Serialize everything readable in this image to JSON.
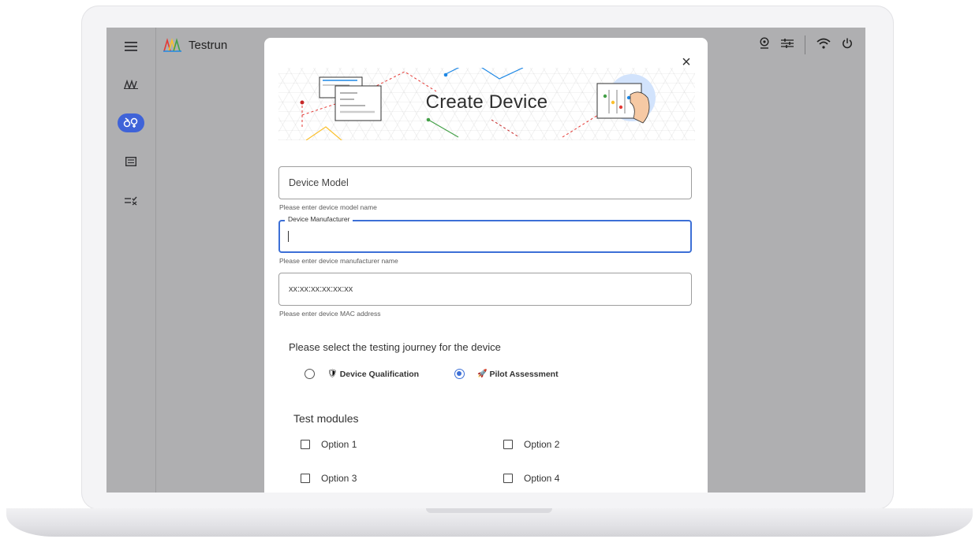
{
  "app": {
    "title": "Testrun"
  },
  "rail": {
    "items": [
      {
        "icon": "devices-icon",
        "glyph": "⩎"
      },
      {
        "icon": "testrun-icon",
        "glyph": "δ♀"
      },
      {
        "icon": "reports-icon",
        "glyph": "☷"
      },
      {
        "icon": "risk-icon",
        "glyph": "≡✕"
      }
    ]
  },
  "topbar": {
    "icons": [
      "certificate-icon",
      "settings-icon",
      "wifi-icon",
      "power-icon"
    ]
  },
  "dialog": {
    "title": "Create Device",
    "close_label": "×",
    "fields": {
      "model": {
        "placeholder": "Device Model",
        "hint": "Please enter device model name"
      },
      "manufacturer": {
        "label": "Device Manufacturer",
        "value": "",
        "hint": "Please enter device manufacturer name"
      },
      "mac": {
        "placeholder": "xx:xx:xx:xx:xx:xx",
        "hint": "Please enter device MAC address"
      }
    },
    "journey": {
      "prompt": "Please select the testing journey for the device",
      "options": [
        {
          "emoji": "🛡",
          "label": "Device Qualification",
          "selected": false
        },
        {
          "emoji": "🚀",
          "label": "Pilot Assessment",
          "selected": true
        }
      ]
    },
    "modules": {
      "title": "Test modules",
      "options": [
        {
          "label": "Option 1",
          "checked": false
        },
        {
          "label": "Option 2",
          "checked": false
        },
        {
          "label": "Option 3",
          "checked": false
        },
        {
          "label": "Option 4",
          "checked": false
        }
      ]
    }
  },
  "colors": {
    "accent": "#3c6fd6",
    "rail_active": "#3f63d8",
    "backdrop": "#afafb1"
  }
}
